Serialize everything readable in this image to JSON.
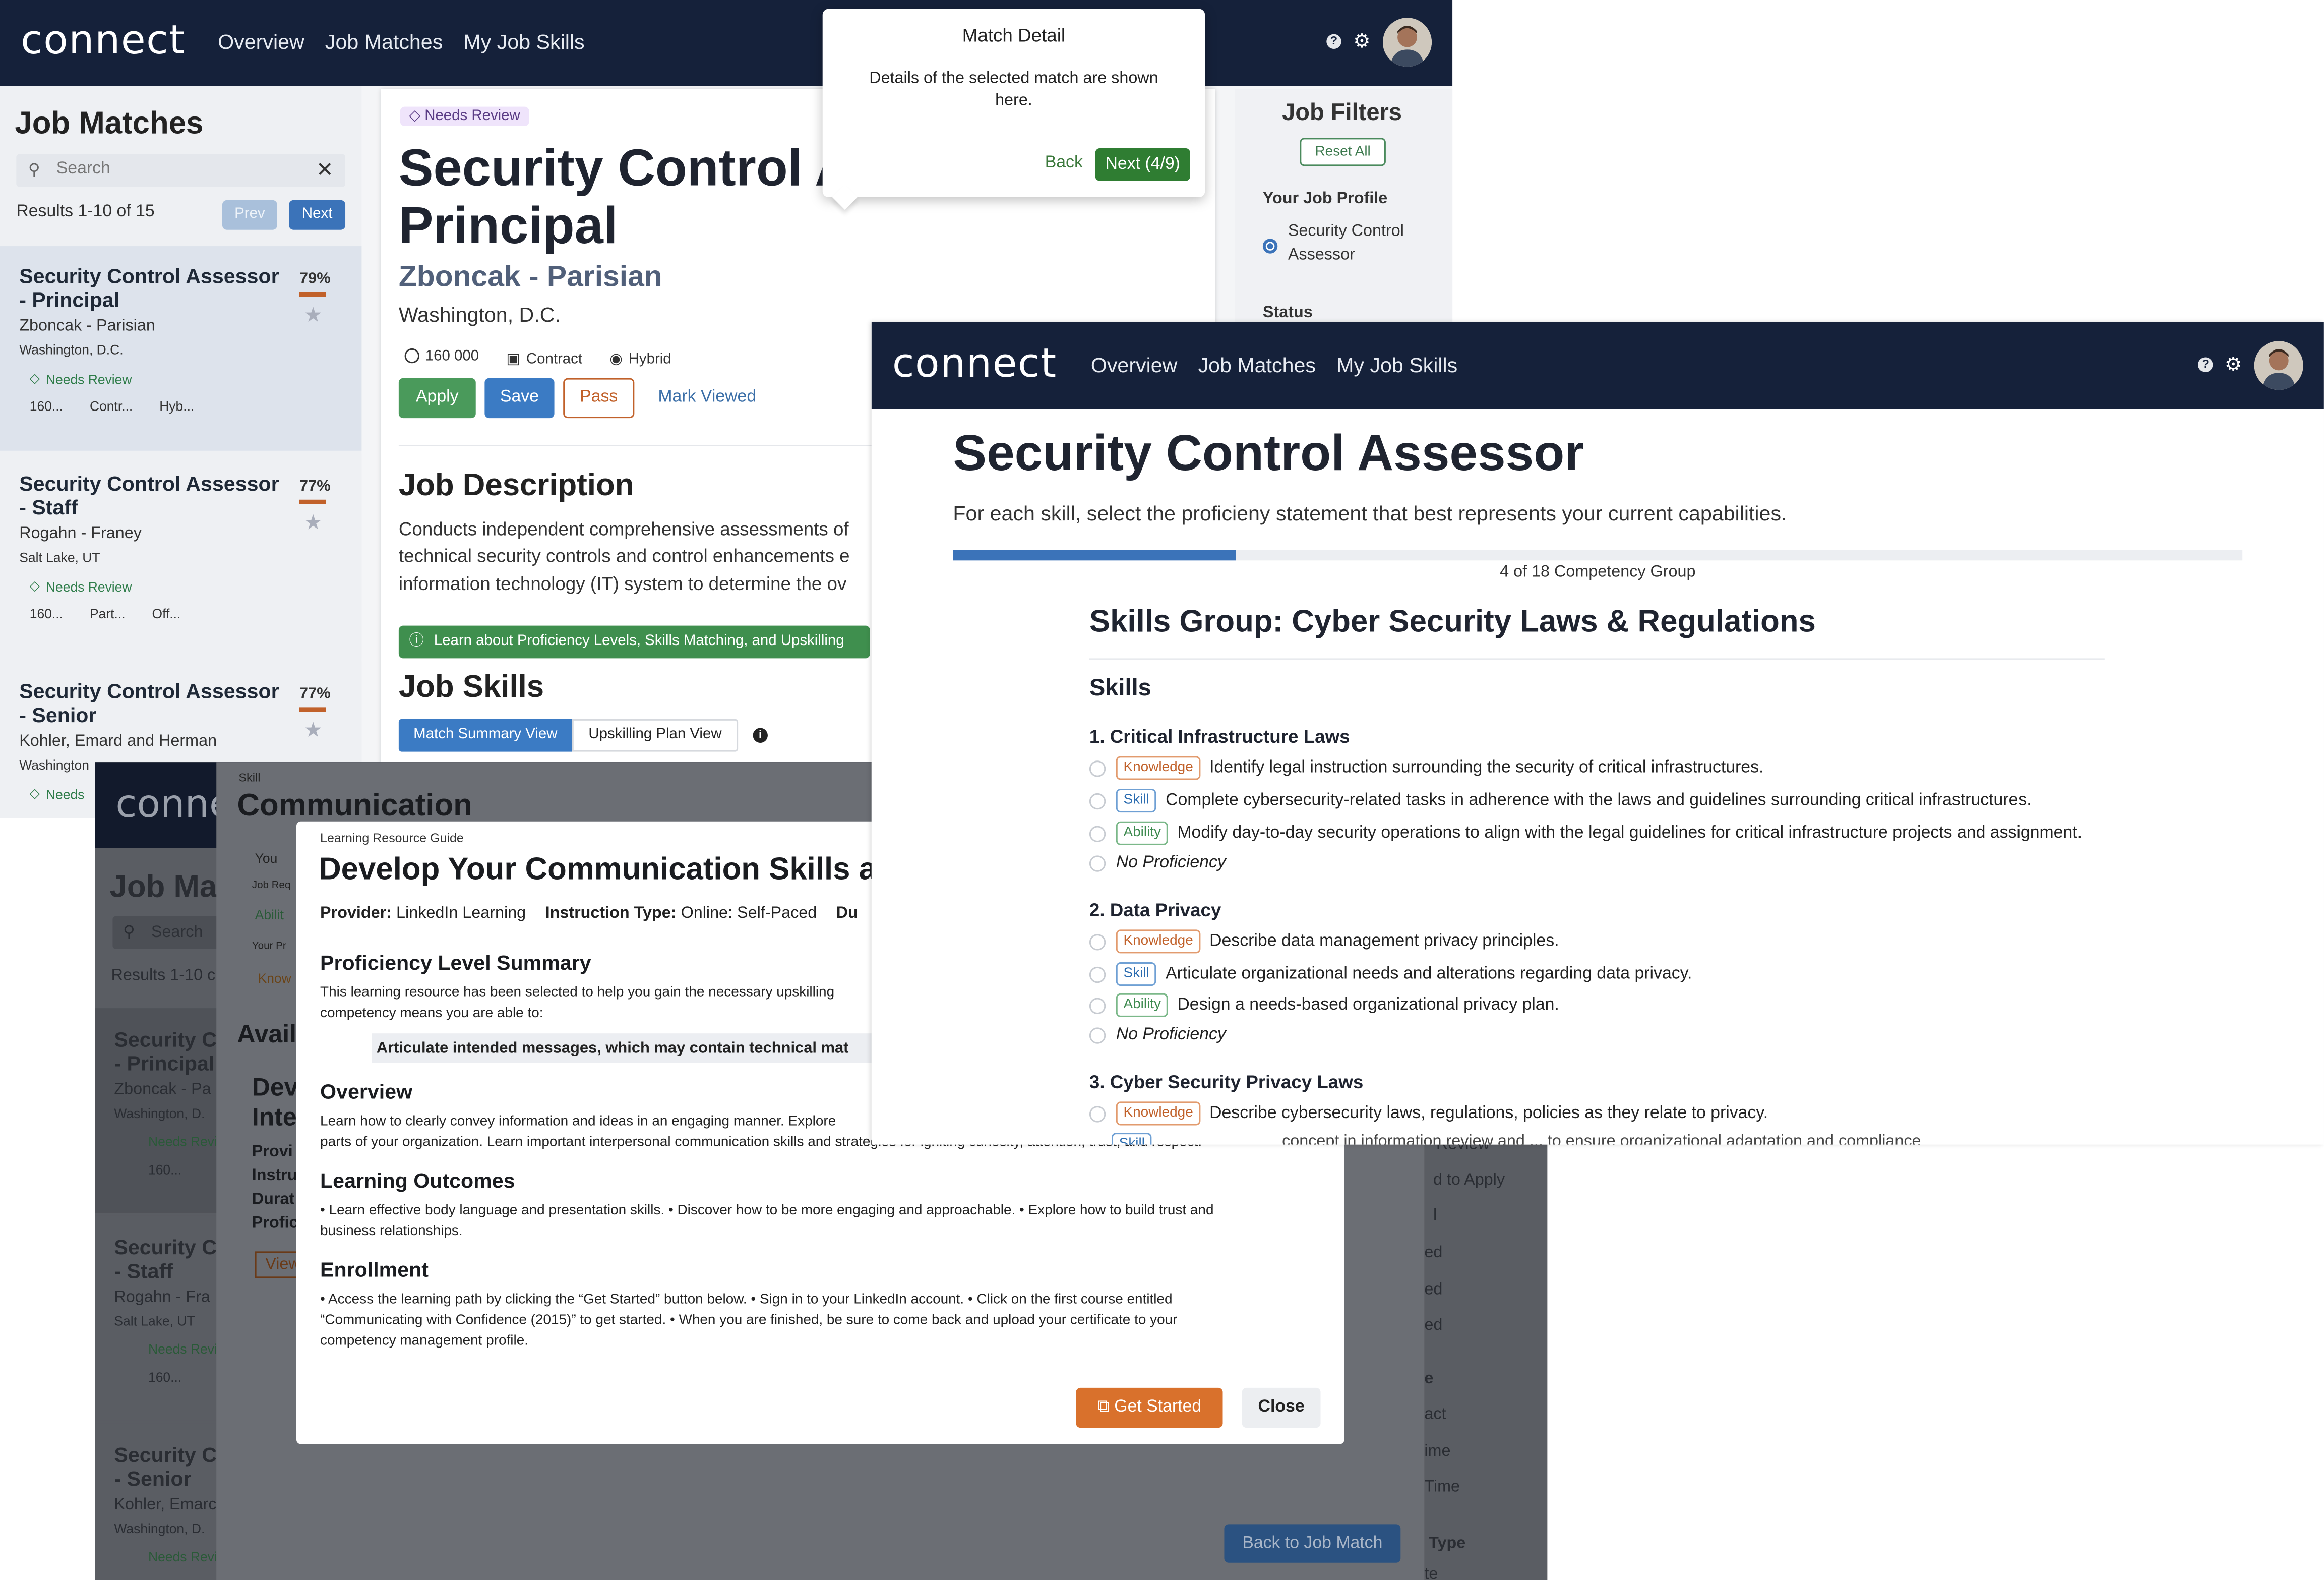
{
  "app": {
    "logo": "connect",
    "nav": [
      "Overview",
      "Job Matches",
      "My Job Skills"
    ]
  },
  "job_matches_panel": {
    "title": "Job Matches",
    "search_placeholder": "Search",
    "results": "Results 1-10 of 15",
    "prev": "Prev",
    "next": "Next",
    "cards": [
      {
        "title_1": "Security Control Assessor",
        "title_2": "- Principal",
        "company": "Zboncak - Parisian",
        "location": "Washington, D.C.",
        "match": "79%",
        "status": "Needs Review",
        "salary": "160...",
        "type": "Contr...",
        "mode": "Hyb..."
      },
      {
        "title_1": "Security Control Assessor",
        "title_2": "- Staff",
        "company": "Rogahn - Franey",
        "location": "Salt Lake, UT",
        "match": "77%",
        "status": "Needs Review",
        "salary": "160...",
        "type": "Part...",
        "mode": "Off..."
      },
      {
        "title_1": "Security Control Assessor",
        "title_2": "- Senior",
        "company": "Kohler, Emard and Herman",
        "location": "Washington",
        "match": "77%",
        "status": "Needs"
      }
    ]
  },
  "job_detail": {
    "status": "Needs Review",
    "title_1": "Security Control A",
    "title_2": "Principal",
    "company": "Zboncak - Parisian",
    "location": "Washington, D.C.",
    "salary": "160 000",
    "type": "Contract",
    "mode": "Hybrid",
    "apply": "Apply",
    "save": "Save",
    "pass": "Pass",
    "mark_viewed": "Mark Viewed",
    "description_heading": "Job Description",
    "description_1": "Conducts independent comprehensive assessments of",
    "description_2": "technical security controls and control enhancements e",
    "description_3": "information technology (IT) system to determine the ov",
    "learn_banner": "Learn about Proficiency Levels, Skills Matching, and Upskilling",
    "skills_heading": "Job Skills",
    "tab_match": "Match Summary View",
    "tab_upskill": "Upskilling Plan View"
  },
  "match_tooltip": {
    "title": "Match Detail",
    "body": "Details of the selected match are shown here.",
    "back": "Back",
    "next": "Next (4/9)"
  },
  "filters": {
    "title": "Job Filters",
    "reset": "Reset All",
    "profile_heading": "Your Job Profile",
    "profile_1": "Security Control",
    "profile_2": "Assessor",
    "status_heading": "Status"
  },
  "skills_page": {
    "title": "Security Control Assessor",
    "subtitle": "For each skill, select the proficieny statement that best represents your current capabilities.",
    "progress": 0.22,
    "progress_label": "4 of 18 Competency Group",
    "group_heading": "Skills Group: Cyber Security Laws & Regulations",
    "skills_heading": "Skills",
    "skills": [
      {
        "name": "1. Critical Infrastructure Laws",
        "knowledge": "Identify legal instruction surrounding the security of critical infrastructures.",
        "skill": "Complete cybersecurity-related tasks in adherence with the laws and guidelines surrounding critical infrastructures.",
        "ability": "Modify day-to-day security operations to align with the legal guidelines for critical infrastructure projects and assignment.",
        "none": "No Proficiency"
      },
      {
        "name": "2. Data Privacy",
        "knowledge": "Describe data management privacy principles.",
        "skill": "Articulate organizational needs and alterations regarding data privacy.",
        "ability": "Design a needs-based organizational privacy plan.",
        "none": "No Proficiency"
      },
      {
        "name": "3. Cyber Security Privacy Laws",
        "knowledge": "Describe cybersecurity laws, regulations, policies as they relate to privacy."
      }
    ],
    "labels": {
      "knowledge": "Knowledge",
      "skill": "Skill",
      "ability": "Ability"
    }
  },
  "background_dark": {
    "skill_label": "Skill",
    "skill_name": "Communication",
    "job_matches": "Job Ma",
    "search": "Search",
    "results": "Results 1-10 c",
    "avail": "Avail",
    "you": "You",
    "job_req": "Job Req",
    "abil": "Abilit",
    "your_pr": "Your Pr",
    "know": "Know",
    "dev": "Dev",
    "inte": "Inte",
    "provi": "Provi",
    "instru": "Instru",
    "durat": "Durat",
    "profic": "Profic",
    "view": "View",
    "cards": [
      {
        "t1": "Security C",
        "t2": "- Principal",
        "c": "Zboncak - Pa",
        "l": "Washington, D.",
        "s": "Needs Revi",
        "v": "160..."
      },
      {
        "t1": "Security C",
        "t2": "- Staff",
        "c": "Rogahn - Fra",
        "l": "Salt Lake, UT",
        "s": "Needs Revi",
        "v": "160..."
      },
      {
        "t1": "Security C",
        "t2": "- Senior",
        "c": "Kohler, Emarc",
        "l": "Washington, D.",
        "s": "Needs Revi"
      }
    ],
    "right_fragments": [
      "Review",
      "d to Apply",
      "l",
      "ed",
      "ed",
      "ed",
      "e",
      "act",
      "ime",
      "Time",
      "Type",
      "te"
    ],
    "back_to_match": "Back to Job Match",
    "overflow_text": "concept in information review and ... to ensure organizational adaptation and compliance"
  },
  "resource_modal": {
    "label": "Learning Resource Guide",
    "title": "Develop Your Communication Skills ar",
    "provider_label": "Provider:",
    "provider": "LinkedIn Learning",
    "instruction_label": "Instruction Type:",
    "instruction": "Online: Self-Paced",
    "du": "Du",
    "summary_heading": "Proficiency Level Summary",
    "summary_1": "This learning resource has been selected to help you gain the necessary upskilling",
    "summary_2": "competency means you are able to:",
    "highlight": "Articulate intended messages, which may contain technical mat",
    "overview_heading": "Overview",
    "overview_1": "Learn how to clearly convey information and ideas in an engaging manner. Explore",
    "overview_2": "parts of your organization. Learn important interpersonal communication skills and strategies for igniting curiosity, attention, trust, and respect.",
    "outcomes_heading": "Learning Outcomes",
    "outcomes_1": "• Learn effective body language and presentation skills. • Discover how to be more engaging and approachable. • Explore how to build trust and",
    "outcomes_2": "business relationships.",
    "enrollment_heading": "Enrollment",
    "enrollment_1": "• Access the learning path by clicking the “Get Started” button below. • Sign in to your LinkedIn account. • Click on the first course entitled",
    "enrollment_2": "“Communicating with Confidence (2015)” to get started. • When you are finished, be sure to come back and upload your certificate to your",
    "enrollment_3": "competency management profile.",
    "get_started": "Get Started",
    "close": "Close"
  },
  "colors": {
    "navy": "#15213a",
    "green": "#2f7d32",
    "blue": "#3b7bc4",
    "orange": "#d9712c"
  }
}
